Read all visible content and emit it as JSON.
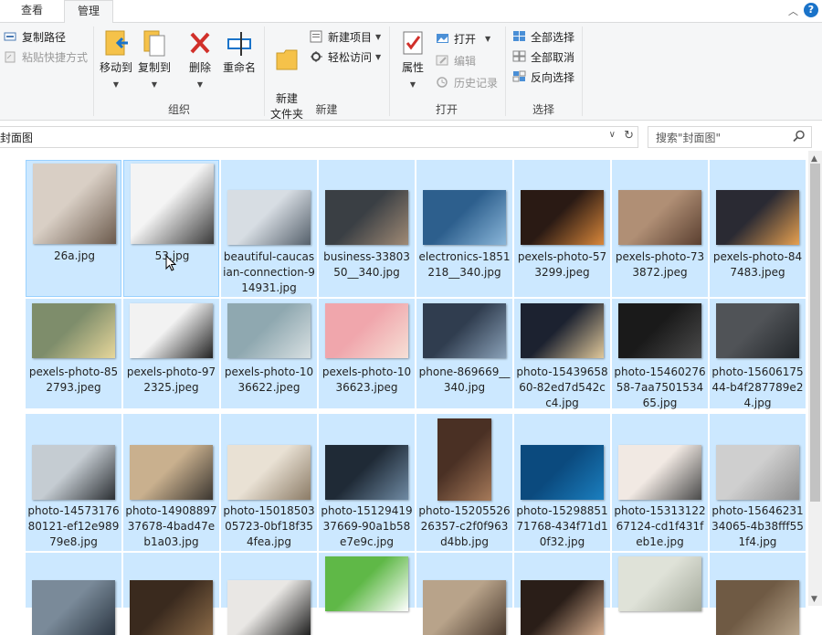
{
  "tabs": {
    "view": "查看",
    "manage": "管理",
    "minimize_glyph": "︿",
    "help": "?"
  },
  "ribbon": {
    "copy_path": "复制路径",
    "paste_shortcut": "粘贴快捷方式",
    "move_to": "移动到",
    "copy_to": "复制到",
    "delete": "删除",
    "rename": "重命名",
    "new_folder": "新建\n文件夹",
    "new_item": "新建项目",
    "easy_access": "轻松访问",
    "properties": "属性",
    "open": "打开",
    "edit": "编辑",
    "history": "历史记录",
    "select_all": "全部选择",
    "select_none": "全部取消",
    "invert_selection": "反向选择",
    "groups": {
      "organize": "组织",
      "new": "新建",
      "open": "打开",
      "select": "选择"
    }
  },
  "address": {
    "path": "封面图",
    "refresh": "↻",
    "dropdown": "∨"
  },
  "search": {
    "placeholder": "搜索\"封面图\""
  },
  "files": [
    {
      "name": "26a.jpg",
      "c1": "#d9cfc5",
      "c2": "#6b5a4c"
    },
    {
      "name": "53.jpg",
      "c1": "#f4f4f4",
      "c2": "#3a3a3a"
    },
    {
      "name": "beautiful-caucasian-connection-914931.jpg",
      "c1": "#d7dde3",
      "c2": "#55606b"
    },
    {
      "name": "business-3380350__340.jpg",
      "c1": "#3a3f44",
      "c2": "#a08a75"
    },
    {
      "name": "electronics-1851218__340.jpg",
      "c1": "#2d5f8d",
      "c2": "#8ab6d9"
    },
    {
      "name": "pexels-photo-573299.jpeg",
      "c1": "#2a1a14",
      "c2": "#d9873a"
    },
    {
      "name": "pexels-photo-733872.jpeg",
      "c1": "#b08f75",
      "c2": "#5a3f30"
    },
    {
      "name": "pexels-photo-847483.jpeg",
      "c1": "#2a2a33",
      "c2": "#e6a050"
    },
    {
      "name": "pexels-photo-852793.jpeg",
      "c1": "#7e8d6b",
      "c2": "#e7d79b"
    },
    {
      "name": "pexels-photo-972325.jpeg",
      "c1": "#f2f2f2",
      "c2": "#222222"
    },
    {
      "name": "pexels-photo-1036622.jpeg",
      "c1": "#8fa8b0",
      "c2": "#d8e0e2"
    },
    {
      "name": "pexels-photo-1036623.jpeg",
      "c1": "#f0a6ac",
      "c2": "#f6e0d6"
    },
    {
      "name": "phone-869669__340.jpg",
      "c1": "#303d4f",
      "c2": "#8aa1b8"
    },
    {
      "name": "photo-1543965860-82ed7d542cc4.jpg",
      "c1": "#1c2230",
      "c2": "#e0c89a"
    },
    {
      "name": "photo-1546027658-7aa750153465.jpg",
      "c1": "#1a1a1a",
      "c2": "#4b4b4b"
    },
    {
      "name": "photo-1560617544-b4f287789e24.jpg",
      "c1": "#505357",
      "c2": "#22262a"
    },
    {
      "name": "photo-1457317680121-ef12e98979e8.jpg",
      "c1": "#c5ccd2",
      "c2": "#2b2f33"
    },
    {
      "name": "photo-1490889737678-4bad47eb1a03.jpg",
      "c1": "#c9b08e",
      "c2": "#3b3630"
    },
    {
      "name": "photo-1501850305723-0bf18f354fea.jpg",
      "c1": "#e9e1d4",
      "c2": "#8b7b66"
    },
    {
      "name": "photo-1512941937669-90a1b58e7e9c.jpg",
      "c1": "#1f2a36",
      "c2": "#6f8aa3"
    },
    {
      "name": "photo-1520552626357-c2f0f963d4bb.jpg",
      "c1": "#4a3024",
      "c2": "#a67a5a"
    },
    {
      "name": "photo-1529885171768-434f71d10f32.jpg",
      "c1": "#0b4a7e",
      "c2": "#1b7fbf"
    },
    {
      "name": "photo-1531312267124-cd1f431feb1e.jpg",
      "c1": "#f1e9e3",
      "c2": "#4a4a4a"
    },
    {
      "name": "photo-1564623134065-4b38fff551f4.jpg",
      "c1": "#cfcfcf",
      "c2": "#8e8e8e"
    },
    {
      "name": "",
      "c1": "#7a8a99",
      "c2": "#2b3642"
    },
    {
      "name": "",
      "c1": "#3a2a1e",
      "c2": "#8a6a48"
    },
    {
      "name": "",
      "c1": "#e9e7e4",
      "c2": "#202020"
    },
    {
      "name": "",
      "c1": "#5fb847",
      "c2": "#ffffff"
    },
    {
      "name": "",
      "c1": "#b8a38a",
      "c2": "#4a3a2e"
    },
    {
      "name": "",
      "c1": "#2a1e18",
      "c2": "#d8b090"
    },
    {
      "name": "",
      "c1": "#dfe2d8",
      "c2": "#a3a89a"
    },
    {
      "name": "",
      "c1": "#6f5a44",
      "c2": "#b7a48a"
    }
  ]
}
